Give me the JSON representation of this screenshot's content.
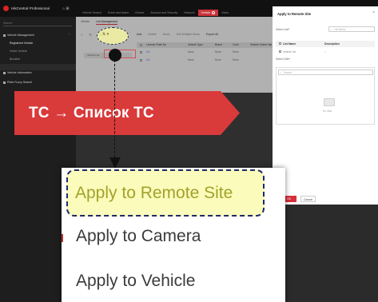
{
  "app": {
    "title": "HikCentral Professional",
    "top_nav": [
      "Vehicle Search",
      "Event and Alarm",
      "Device",
      "Account and Security",
      "Network",
      "Vehicle",
      "Video"
    ],
    "top_nav_active_index": 5
  },
  "sidebar": {
    "search_placeholder": "Search",
    "group_label": "Vehicle Management",
    "items": [
      "Registered Vehicle",
      "Visitor Vehicle",
      "Blocklist"
    ],
    "active_item_index": 0,
    "sections": [
      "Vehicle Information",
      "Plate Fuzzy Search"
    ]
  },
  "main": {
    "tabs": [
      "Vehicle",
      "List Management"
    ],
    "active_tab_index": 1,
    "tree_item": "Vehicle List",
    "toolbar": [
      "Add",
      "Delete",
      "Move",
      "Edit Multiple Items",
      "Export All"
    ],
    "table": {
      "columns": [
        "License Plate No.",
        "Vehicle Type",
        "Brand",
        "Color",
        "Vehicle Owner Name"
      ],
      "rows": [
        [
          "AA",
          "None",
          "None",
          "None"
        ],
        [
          "AA",
          "None",
          "None",
          "None"
        ]
      ]
    }
  },
  "dialog": {
    "title": "Apply to Remote Site",
    "close_label": "×",
    "list_label": "Select List*",
    "list_search_placeholder": "List Name",
    "list_columns": [
      "List Name",
      "Description"
    ],
    "list_rows": [
      [
        "Vehicle List",
        "--"
      ]
    ],
    "site_label": "Select Site*",
    "site_search_placeholder": "Search",
    "no_data": "No data.",
    "ok_label": "OK",
    "cancel_label": "Cancel"
  },
  "annotation": {
    "banner_text": "ТС → Список ТС",
    "banner_color": "#d93a3a",
    "highlight_color": "#fbfbbb",
    "dash_color": "#1b2a6b"
  },
  "context_menu": {
    "items": [
      "Apply to Remote Site",
      "Apply to Camera",
      "Apply to Vehicle"
    ],
    "highlighted_index": 0
  }
}
